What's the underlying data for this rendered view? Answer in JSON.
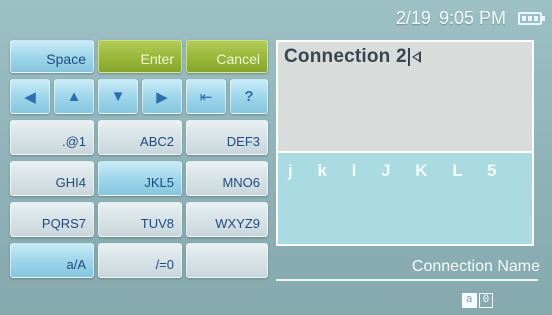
{
  "status": {
    "date": "2/19",
    "time": "9:05 PM",
    "battery_icon": "battery-icon"
  },
  "keyboard": {
    "space_label": "Space",
    "enter_label": "Enter",
    "cancel_label": "Cancel",
    "arrows": {
      "left": "◀",
      "up": "▲",
      "down": "▼",
      "right": "▶",
      "backspace": "⇤",
      "help": "?"
    },
    "keys": [
      [
        ".@1",
        "ABC2",
        "DEF3"
      ],
      [
        "GHI4",
        "JKL5",
        "MNO6"
      ],
      [
        "PQRS7",
        "TUV8",
        "WXYZ9"
      ],
      [
        "a/A",
        "/=0",
        ""
      ]
    ]
  },
  "editor": {
    "text": "Connection 2"
  },
  "candidates": {
    "chars": "j k l J K L 5"
  },
  "field": {
    "label": "Connection Name"
  },
  "mode": {
    "left": "a",
    "right": "0"
  },
  "colors": {
    "accent_green": "#9ab83a",
    "key_blue": "#9fd6ea",
    "text_blue": "#1f4b7e"
  }
}
